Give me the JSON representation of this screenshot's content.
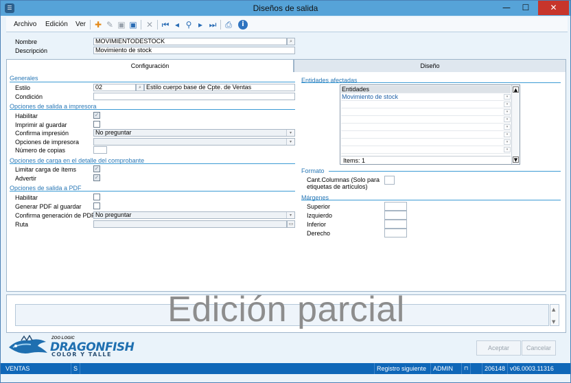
{
  "window": {
    "title": "Diseños de salida",
    "minimize": "—",
    "maximize": "☐",
    "close": "✕",
    "app_icon": "zoo-logic-app-icon"
  },
  "menu": {
    "items": [
      "Archivo",
      "Edición",
      "Ver"
    ]
  },
  "toolbar": {
    "icons": [
      "add-icon",
      "edit-icon",
      "save-icon",
      "save-as-icon",
      "delete-icon",
      "first-record-icon",
      "previous-record-icon",
      "search-icon",
      "next-record-icon",
      "last-record-icon",
      "preview-icon",
      "info-icon"
    ]
  },
  "header": {
    "nombre_label": "Nombre",
    "nombre_value": "MOVIMIENTODESTOCK",
    "descripcion_label": "Descripción",
    "descripcion_value": "Movimiento de stock"
  },
  "tabs": [
    "Configuración",
    "Diseño"
  ],
  "generales": {
    "title": "Generales",
    "estilo_label": "Estilo",
    "estilo_code": "02",
    "estilo_desc": "Estilo cuerpo base de Cpte. de Ventas",
    "condicion_label": "Condición",
    "condicion_value": ""
  },
  "impresora": {
    "title": "Opciones de salida a impresora",
    "habilitar_label": "Habilitar",
    "habilitar_checked": true,
    "imprimir_label": "Imprimir al guardar",
    "imprimir_checked": false,
    "confirma_label": "Confirma impresión",
    "confirma_value": "No preguntar",
    "opciones_label": "Opciones de impresora",
    "opciones_value": "",
    "copias_label": "Número de copias",
    "copias_value": ""
  },
  "detalle": {
    "title": "Opciones de carga en el detalle del comprobante",
    "limitar_label": "Limitar carga de ítems",
    "limitar_checked": true,
    "advertir_label": "Advertir",
    "advertir_checked": true
  },
  "pdf": {
    "title": "Opciones de salida a PDF",
    "habilitar_label": "Habilitar",
    "habilitar_checked": false,
    "generar_label": "Generar PDF al guardar",
    "generar_checked": false,
    "confirma_label": "Confirma generación de PDF",
    "confirma_value": "No preguntar",
    "ruta_label": "Ruta",
    "ruta_value": ""
  },
  "entidades": {
    "title": "Entidades afectadas",
    "header": "Entidades",
    "rows": [
      "Movimiento de stock",
      "",
      "",
      "",
      "",
      "",
      "",
      ""
    ],
    "footer": "Items: 1"
  },
  "formato": {
    "title": "Formato",
    "columnas_label": "Cant.Columnas (Solo para etiquetas de artículos)",
    "columnas_value": ""
  },
  "margenes": {
    "title": "Márgenes",
    "items": [
      {
        "label": "Superior",
        "value": ""
      },
      {
        "label": "Izquierdo",
        "value": ""
      },
      {
        "label": "Inferior",
        "value": ""
      },
      {
        "label": "Derecho",
        "value": ""
      }
    ]
  },
  "overlay": {
    "text": "Edición parcial"
  },
  "logo": {
    "company": "ZOO LOGIC",
    "product": "DRAGONFISH",
    "edition": "COLOR Y TALLE"
  },
  "actions": {
    "accept": "Aceptar",
    "cancel": "Cancelar"
  },
  "status": {
    "module": "VENTAS",
    "s": "S",
    "record": "Registro siguiente",
    "user": "ADMIN",
    "lock_icon": "lock-icon",
    "id": "206148",
    "version": "v06.0003.11316"
  },
  "colors": {
    "titlebar": "#56a3d8",
    "section": "#2a78b6",
    "statusbar": "#0f67b8"
  }
}
